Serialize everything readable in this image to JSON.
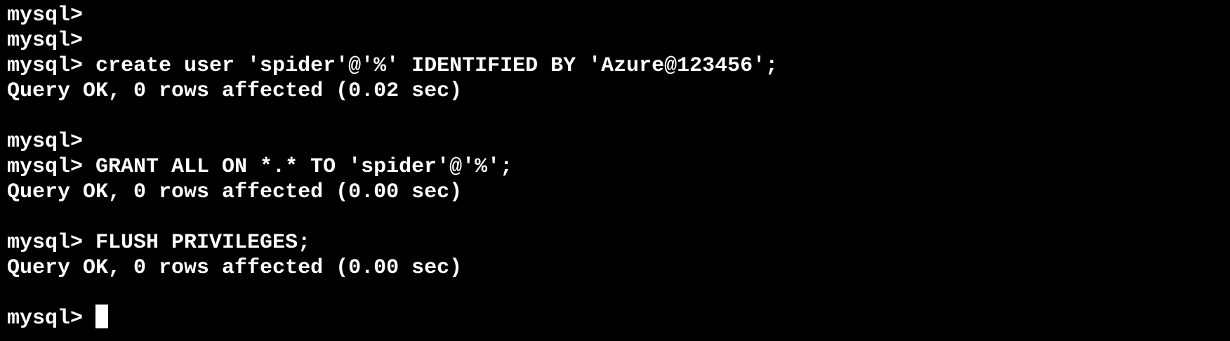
{
  "terminal": {
    "prompt": "mysql>",
    "cursor_visible": true,
    "colors": {
      "background": "#000000",
      "foreground": "#ffffff"
    },
    "lines": [
      "mysql>",
      "mysql>",
      "mysql> create user 'spider'@'%' IDENTIFIED BY 'Azure@123456';",
      "Query OK, 0 rows affected (0.02 sec)",
      "",
      "mysql>",
      "mysql> GRANT ALL ON *.* TO 'spider'@'%';",
      "Query OK, 0 rows affected (0.00 sec)",
      "",
      "mysql> FLUSH PRIVILEGES;",
      "Query OK, 0 rows affected (0.00 sec)",
      "",
      "mysql> "
    ]
  }
}
